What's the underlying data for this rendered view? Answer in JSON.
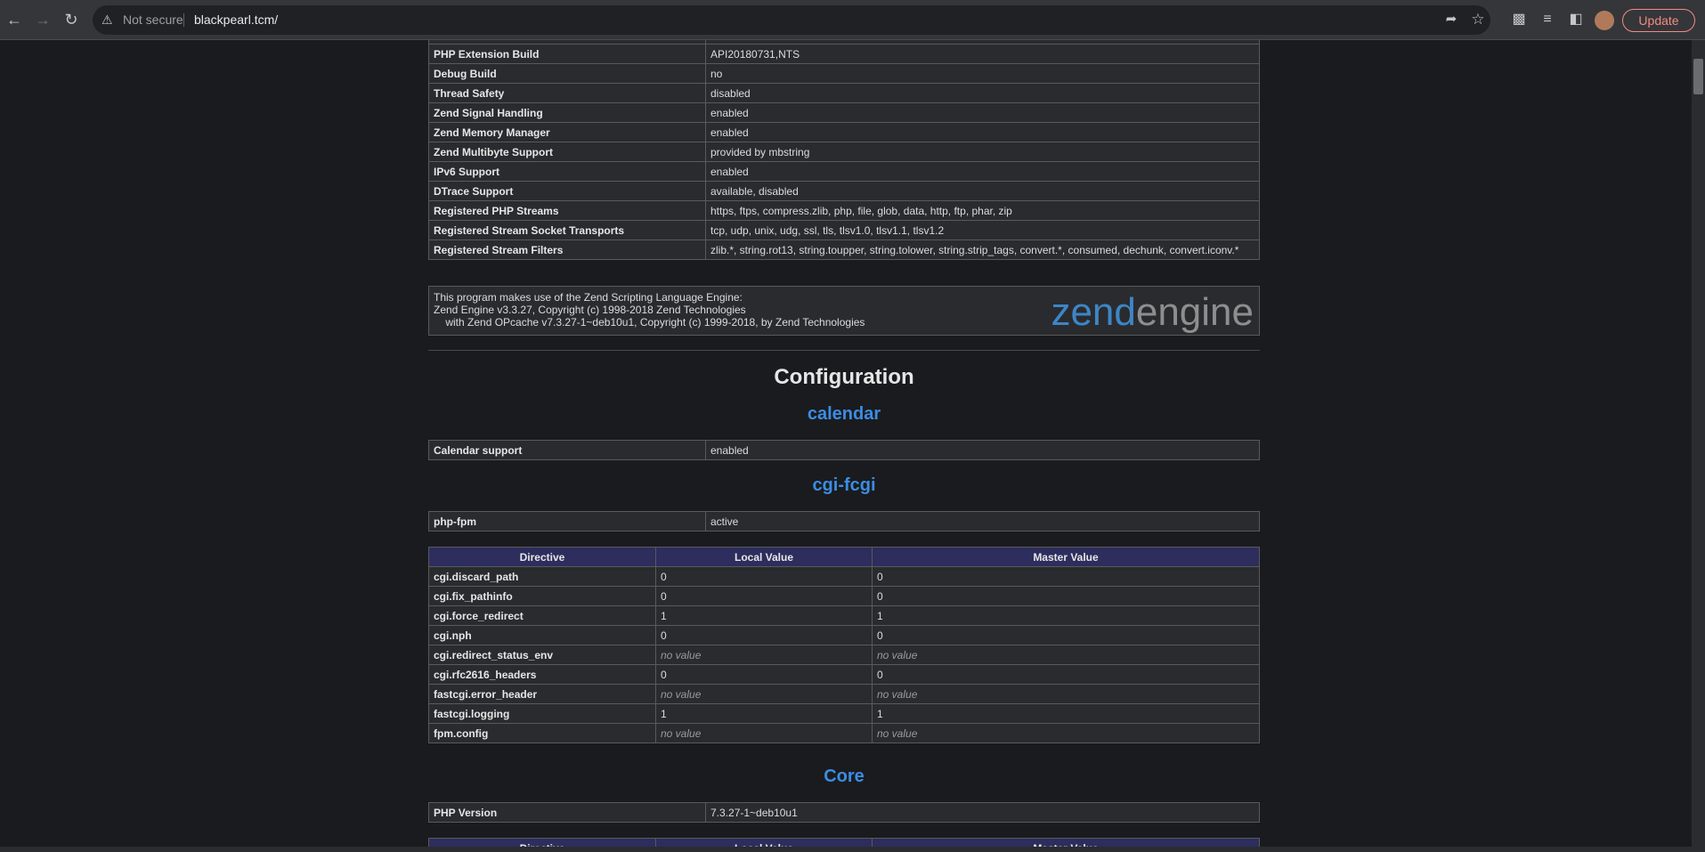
{
  "browser": {
    "security_label": "Not secure",
    "url": "blackpearl.tcm/",
    "update_label": "Update"
  },
  "top_table": [
    {
      "name": "PHP Extension Build",
      "value": "API20180731,NTS"
    },
    {
      "name": "Debug Build",
      "value": "no"
    },
    {
      "name": "Thread Safety",
      "value": "disabled"
    },
    {
      "name": "Zend Signal Handling",
      "value": "enabled"
    },
    {
      "name": "Zend Memory Manager",
      "value": "enabled"
    },
    {
      "name": "Zend Multibyte Support",
      "value": "provided by mbstring"
    },
    {
      "name": "IPv6 Support",
      "value": "enabled"
    },
    {
      "name": "DTrace Support",
      "value": "available, disabled"
    },
    {
      "name": "Registered PHP Streams",
      "value": "https, ftps, compress.zlib, php, file, glob, data, http, ftp, phar, zip"
    },
    {
      "name": "Registered Stream Socket Transports",
      "value": "tcp, udp, unix, udg, ssl, tls, tlsv1.0, tlsv1.1, tlsv1.2"
    },
    {
      "name": "Registered Stream Filters",
      "value": "zlib.*, string.rot13, string.toupper, string.tolower, string.strip_tags, convert.*, consumed, dechunk, convert.iconv.*"
    }
  ],
  "zend": {
    "line1": "This program makes use of the Zend Scripting Language Engine:",
    "line2": "Zend Engine v3.3.27, Copyright (c) 1998-2018 Zend Technologies",
    "line3": "    with Zend OPcache v7.3.27-1~deb10u1, Copyright (c) 1999-2018, by Zend Technologies",
    "logo_a": "zend",
    "logo_b": "engine"
  },
  "configuration_heading": "Configuration",
  "calendar": {
    "heading": "calendar",
    "rows": [
      {
        "name": "Calendar support",
        "value": "enabled"
      }
    ]
  },
  "cgi": {
    "heading": "cgi-fcgi",
    "rows": [
      {
        "name": "php-fpm",
        "value": "active"
      }
    ],
    "headers": [
      "Directive",
      "Local Value",
      "Master Value"
    ],
    "directives": [
      {
        "name": "cgi.discard_path",
        "local": "0",
        "master": "0",
        "novalue": false
      },
      {
        "name": "cgi.fix_pathinfo",
        "local": "0",
        "master": "0",
        "novalue": false
      },
      {
        "name": "cgi.force_redirect",
        "local": "1",
        "master": "1",
        "novalue": false
      },
      {
        "name": "cgi.nph",
        "local": "0",
        "master": "0",
        "novalue": false
      },
      {
        "name": "cgi.redirect_status_env",
        "local": "no value",
        "master": "no value",
        "novalue": true
      },
      {
        "name": "cgi.rfc2616_headers",
        "local": "0",
        "master": "0",
        "novalue": false
      },
      {
        "name": "fastcgi.error_header",
        "local": "no value",
        "master": "no value",
        "novalue": true
      },
      {
        "name": "fastcgi.logging",
        "local": "1",
        "master": "1",
        "novalue": false
      },
      {
        "name": "fpm.config",
        "local": "no value",
        "master": "no value",
        "novalue": true
      }
    ]
  },
  "core": {
    "heading": "Core",
    "rows": [
      {
        "name": "PHP Version",
        "value": "7.3.27-1~deb10u1"
      }
    ],
    "headers": [
      "Directive",
      "Local Value",
      "Master Value"
    ]
  }
}
